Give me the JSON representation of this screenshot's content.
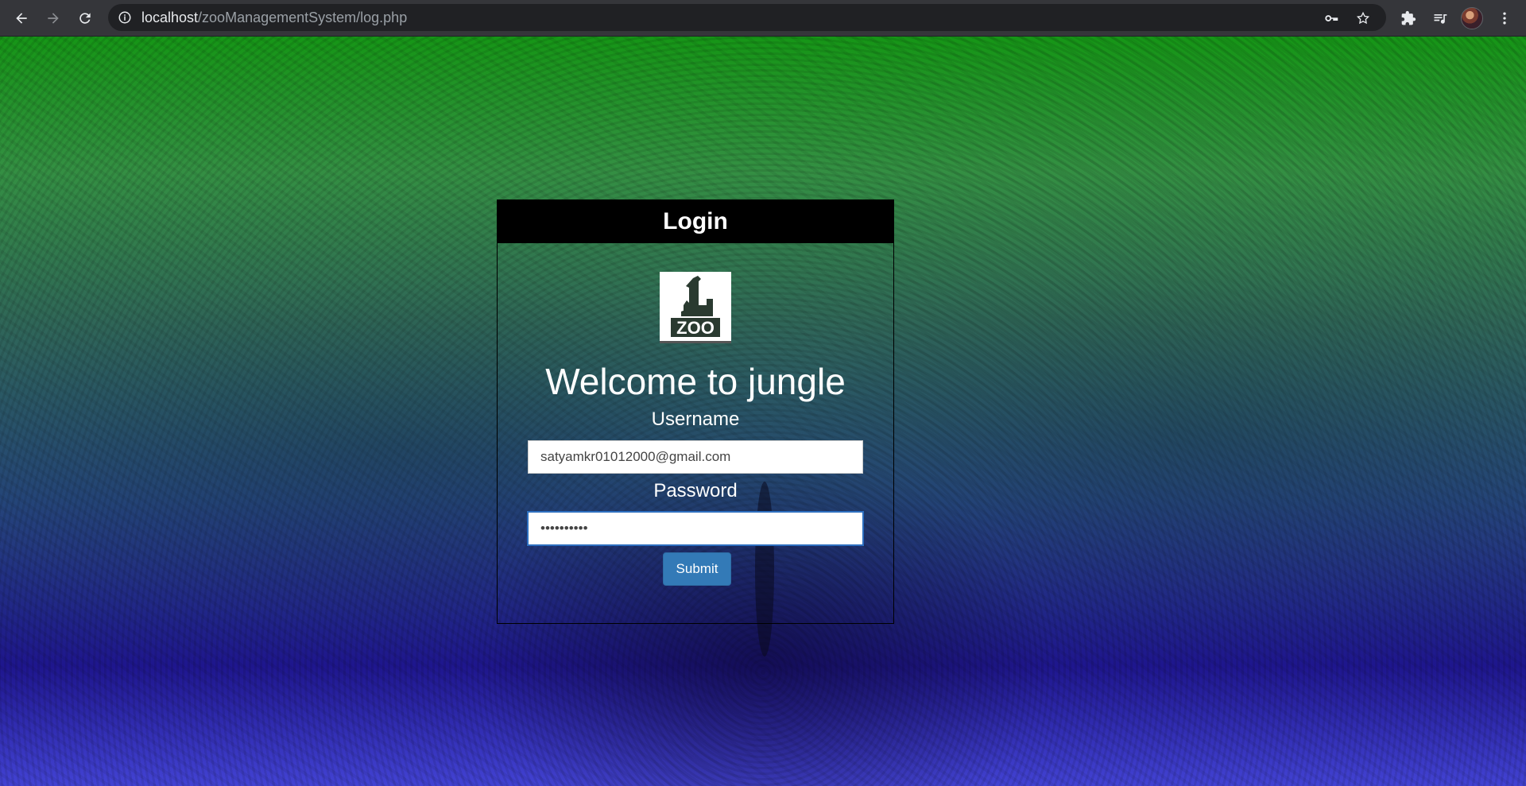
{
  "browser": {
    "url_host": "localhost",
    "url_path": "/zooManagementSystem/log.php",
    "icons": {
      "back": "arrow-left-icon",
      "forward": "arrow-right-icon",
      "reload": "reload-icon",
      "info": "info-icon",
      "key": "key-icon",
      "star": "star-icon",
      "extensions": "puzzle-icon",
      "media": "media-queue-icon",
      "menu": "kebab-menu-icon"
    }
  },
  "login": {
    "header": "Login",
    "logo_text": "ZOO",
    "welcome": "Welcome to jungle",
    "username_label": "Username",
    "username_value": "satyamkr01012000@gmail.com",
    "password_label": "Password",
    "password_value": "••••••••••",
    "submit_label": "Submit"
  },
  "colors": {
    "header_bg": "#000000",
    "button_bg": "#337ab7",
    "gradient_top": "#14aa14",
    "gradient_bottom": "#1e14a0"
  }
}
